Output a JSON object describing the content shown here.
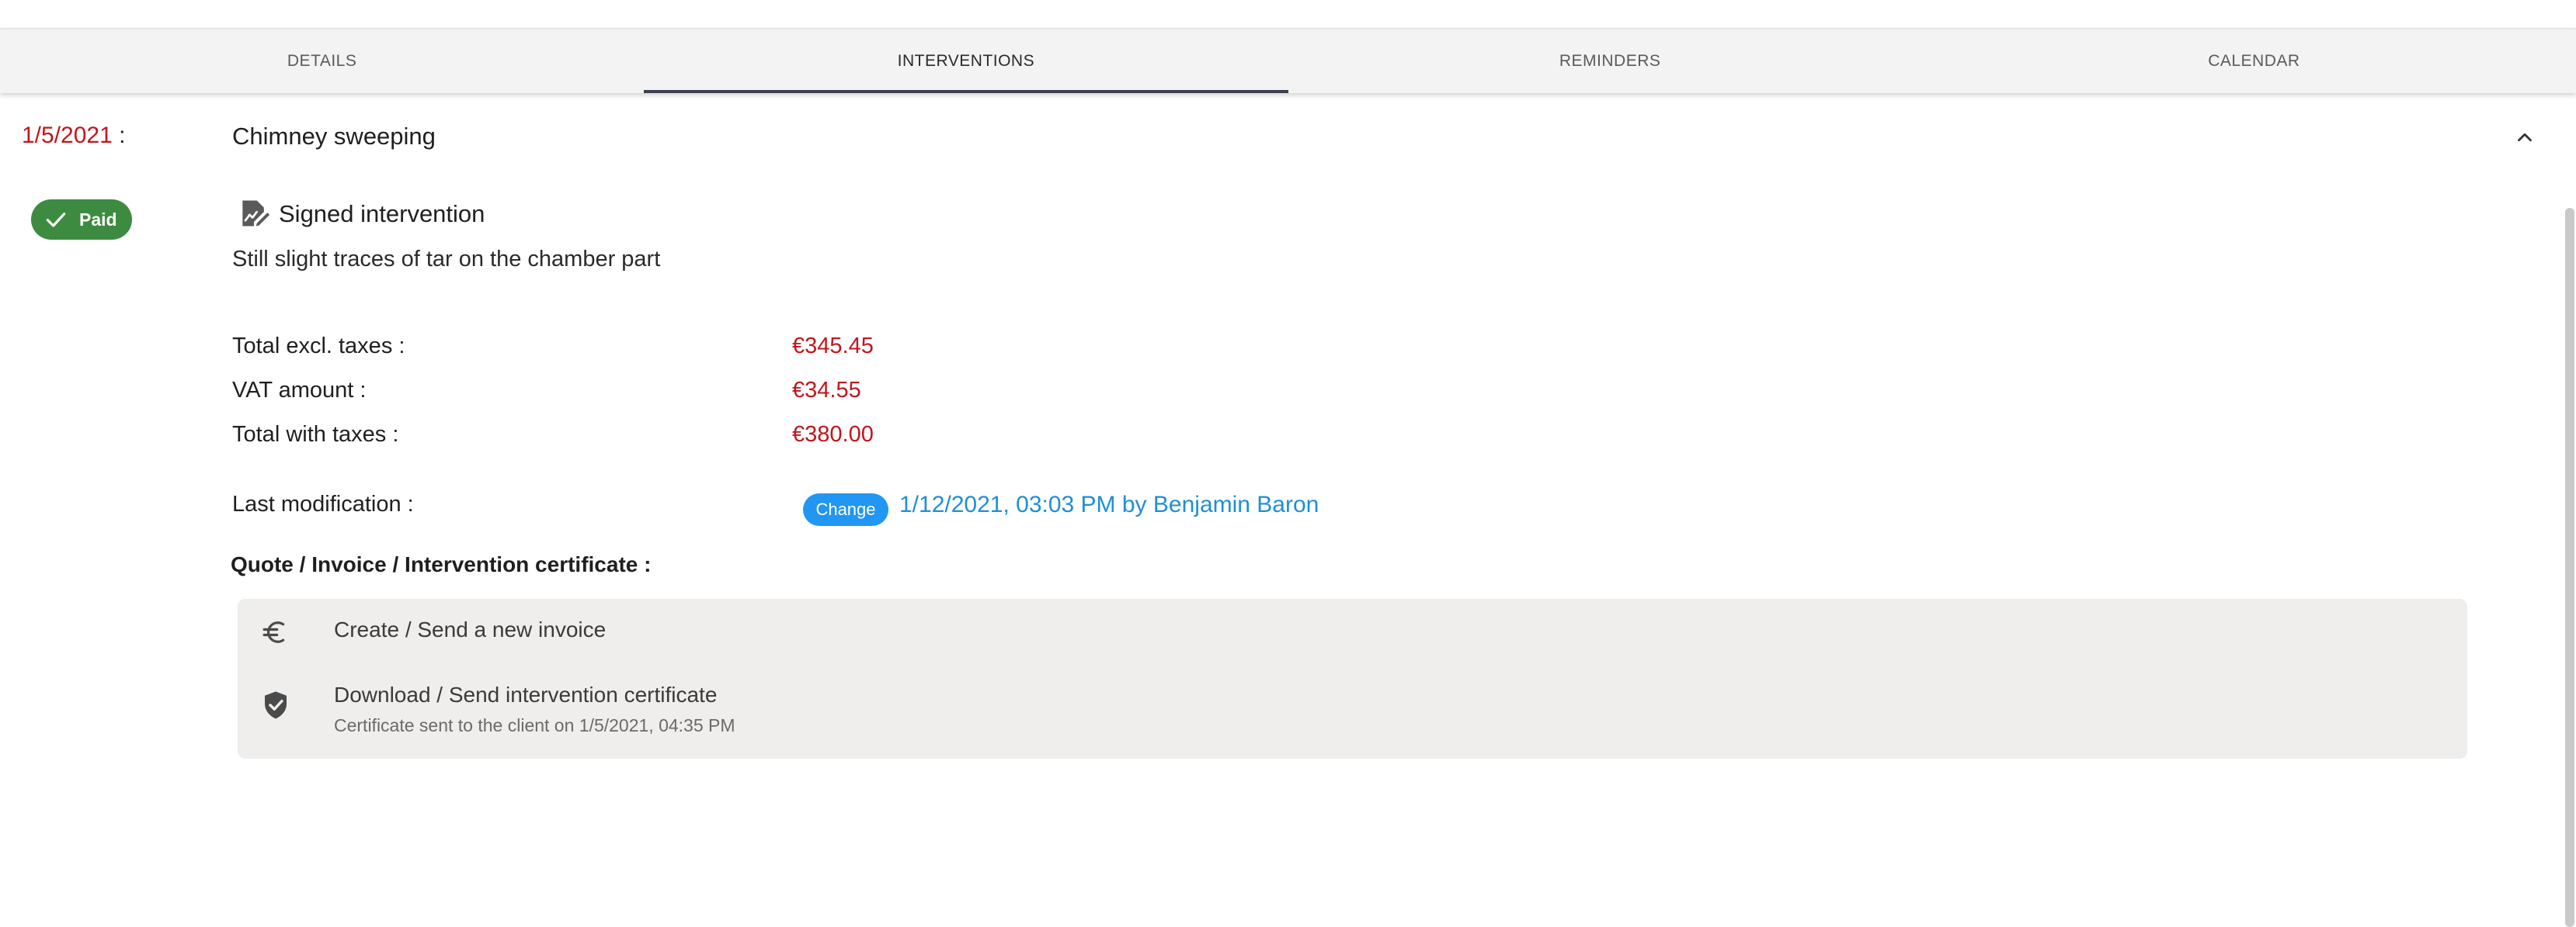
{
  "tabs": [
    {
      "label": "DETAILS",
      "active": false
    },
    {
      "label": "INTERVENTIONS",
      "active": true
    },
    {
      "label": "REMINDERS",
      "active": false
    },
    {
      "label": "CALENDAR",
      "active": false
    }
  ],
  "intervention": {
    "date": "1/5/2021",
    "date_suffix": " :",
    "title": "Chimney sweeping",
    "status_badge": "Paid",
    "signed_label": "Signed intervention",
    "note": "Still slight traces of tar on the chamber part",
    "totals": [
      {
        "label": "Total excl. taxes :",
        "value": "€345.45"
      },
      {
        "label": "VAT amount :",
        "value": "€34.55"
      },
      {
        "label": "Total with taxes :",
        "value": "€380.00"
      }
    ],
    "last_modification": {
      "label": "Last modification :",
      "button": "Change",
      "value": "1/12/2021, 03:03 PM by Benjamin Baron"
    },
    "documents_label": "Quote / Invoice / Intervention certificate :",
    "actions": [
      {
        "icon": "euro-icon",
        "title": "Create / Send a new invoice",
        "subtitle": ""
      },
      {
        "icon": "shield-check-icon",
        "title": "Download / Send intervention certificate",
        "subtitle": "Certificate sent to the client on 1/5/2021, 04:35 PM"
      }
    ]
  },
  "colors": {
    "accent_red": "#c0161c",
    "paid_green": "#3d8b40",
    "link_blue": "#1e8fd6",
    "button_blue": "#2196f3"
  }
}
